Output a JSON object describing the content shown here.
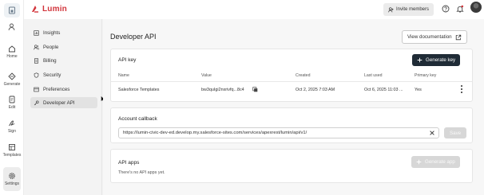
{
  "app": {
    "name": "Lumin",
    "brand_color": "#d2343b"
  },
  "header": {
    "invite_label": "Invite members",
    "icons": [
      "person-plus-icon",
      "help-icon",
      "bell-icon",
      "avatar"
    ]
  },
  "rail": {
    "items": [
      {
        "label": "Home",
        "icon": "home-icon"
      },
      {
        "label": "Generate",
        "icon": "generate-icon"
      },
      {
        "label": "Edit",
        "icon": "edit-icon"
      },
      {
        "label": "Sign",
        "icon": "sign-icon"
      },
      {
        "label": "Templates",
        "icon": "templates-icon"
      },
      {
        "label": "Settings",
        "icon": "gear-icon"
      }
    ]
  },
  "subnav": {
    "items": [
      {
        "label": "Insights",
        "icon": "insights-icon"
      },
      {
        "label": "People",
        "icon": "people-icon"
      },
      {
        "label": "Billing",
        "icon": "billing-icon"
      },
      {
        "label": "Security",
        "icon": "shield-icon"
      },
      {
        "label": "Preferences",
        "icon": "preferences-icon"
      },
      {
        "label": "Developer API",
        "icon": "key-icon",
        "active": true
      }
    ]
  },
  "main": {
    "title": "Developer API",
    "docs_button": "View documentation",
    "api_key": {
      "title": "API key",
      "generate_button": "Generate key",
      "columns": [
        "Name",
        "Value",
        "Created",
        "Last used",
        "Primary key"
      ],
      "rows": [
        {
          "name": "Salesforce Templates",
          "value": "bw3quIgi2nxrivfq...8c4",
          "created": "Oct 2, 2025 7:03 AM",
          "last_used": "Oct 6, 2025 11:03 ...",
          "primary": "Yes"
        }
      ]
    },
    "callback": {
      "title": "Account callback",
      "url": "https://lumin-civic-dev-ed.develop.my.salesforce-sites.com/services/apexrest/lumin/api/v1/",
      "save_label": "Save"
    },
    "api_apps": {
      "title": "API apps",
      "empty_text": "There's no API apps yet.",
      "generate_button": "Generate app"
    }
  }
}
